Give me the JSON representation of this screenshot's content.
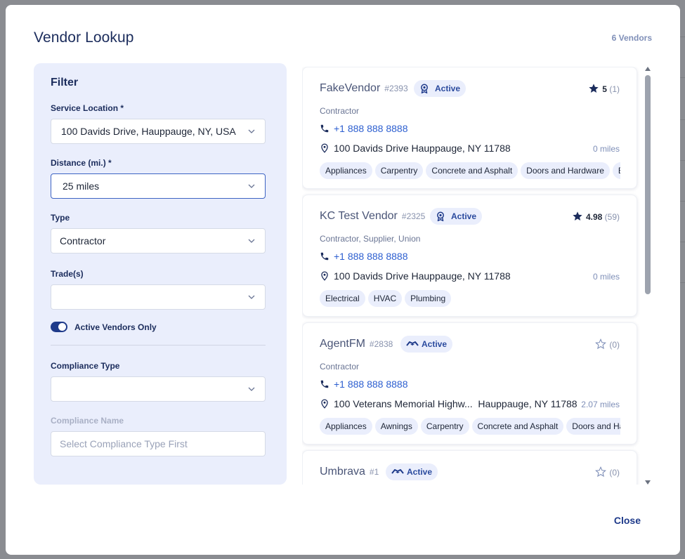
{
  "modal": {
    "title": "Vendor Lookup",
    "vendor_count": "6 Vendors",
    "close_label": "Close"
  },
  "filter": {
    "title": "Filter",
    "service_location": {
      "label": "Service Location *",
      "value": "100 Davids Drive, Hauppauge, NY, USA"
    },
    "distance": {
      "label": "Distance (mi.) *",
      "value": "25 miles"
    },
    "type": {
      "label": "Type",
      "value": "Contractor"
    },
    "trades": {
      "label": "Trade(s)",
      "value": ""
    },
    "active_only": {
      "label": "Active Vendors Only",
      "checked": true
    },
    "compliance_type": {
      "label": "Compliance Type",
      "value": ""
    },
    "compliance_name": {
      "label": "Compliance Name",
      "placeholder": "Select Compliance Type First"
    }
  },
  "vendors": [
    {
      "name": "FakeVendor",
      "id": "#2393",
      "status": "Active",
      "status_icon": "award-icon",
      "rating": "5",
      "rating_count": "(1)",
      "rating_filled": true,
      "type": "Contractor",
      "phone": "+1 888 888 8888",
      "address": "100 Davids Drive Hauppauge, NY 11788",
      "miles": "0 miles",
      "trades": [
        "Appliances",
        "Carpentry",
        "Concrete and Asphalt",
        "Doors and Hardware",
        "Electrical"
      ]
    },
    {
      "name": "KC Test Vendor",
      "id": "#2325",
      "status": "Active",
      "status_icon": "award-icon",
      "rating": "4.98",
      "rating_count": "(59)",
      "rating_filled": true,
      "type": "Contractor, Supplier, Union",
      "phone": "+1 888 888 8888",
      "address": "100 Davids Drive Hauppauge, NY 11788",
      "miles": "0 miles",
      "trades": [
        "Electrical",
        "HVAC",
        "Plumbing"
      ]
    },
    {
      "name": "AgentFM",
      "id": "#2838",
      "status": "Active",
      "status_icon": "handshake-icon",
      "rating": "",
      "rating_count": "(0)",
      "rating_filled": false,
      "type": "Contractor",
      "phone": "+1 888 888 8888",
      "address": "100 Veterans Memorial Highw...  Hauppauge, NY 11788",
      "miles": "2.07 miles",
      "trades": [
        "Appliances",
        "Awnings",
        "Carpentry",
        "Concrete and Asphalt",
        "Doors and Hardware"
      ]
    },
    {
      "name": "Umbrava",
      "id": "#1",
      "status": "Active",
      "status_icon": "handshake-icon",
      "rating": "",
      "rating_count": "(0)",
      "rating_filled": false,
      "type": "",
      "phone": "",
      "address": "",
      "miles": "",
      "trades": []
    }
  ]
}
